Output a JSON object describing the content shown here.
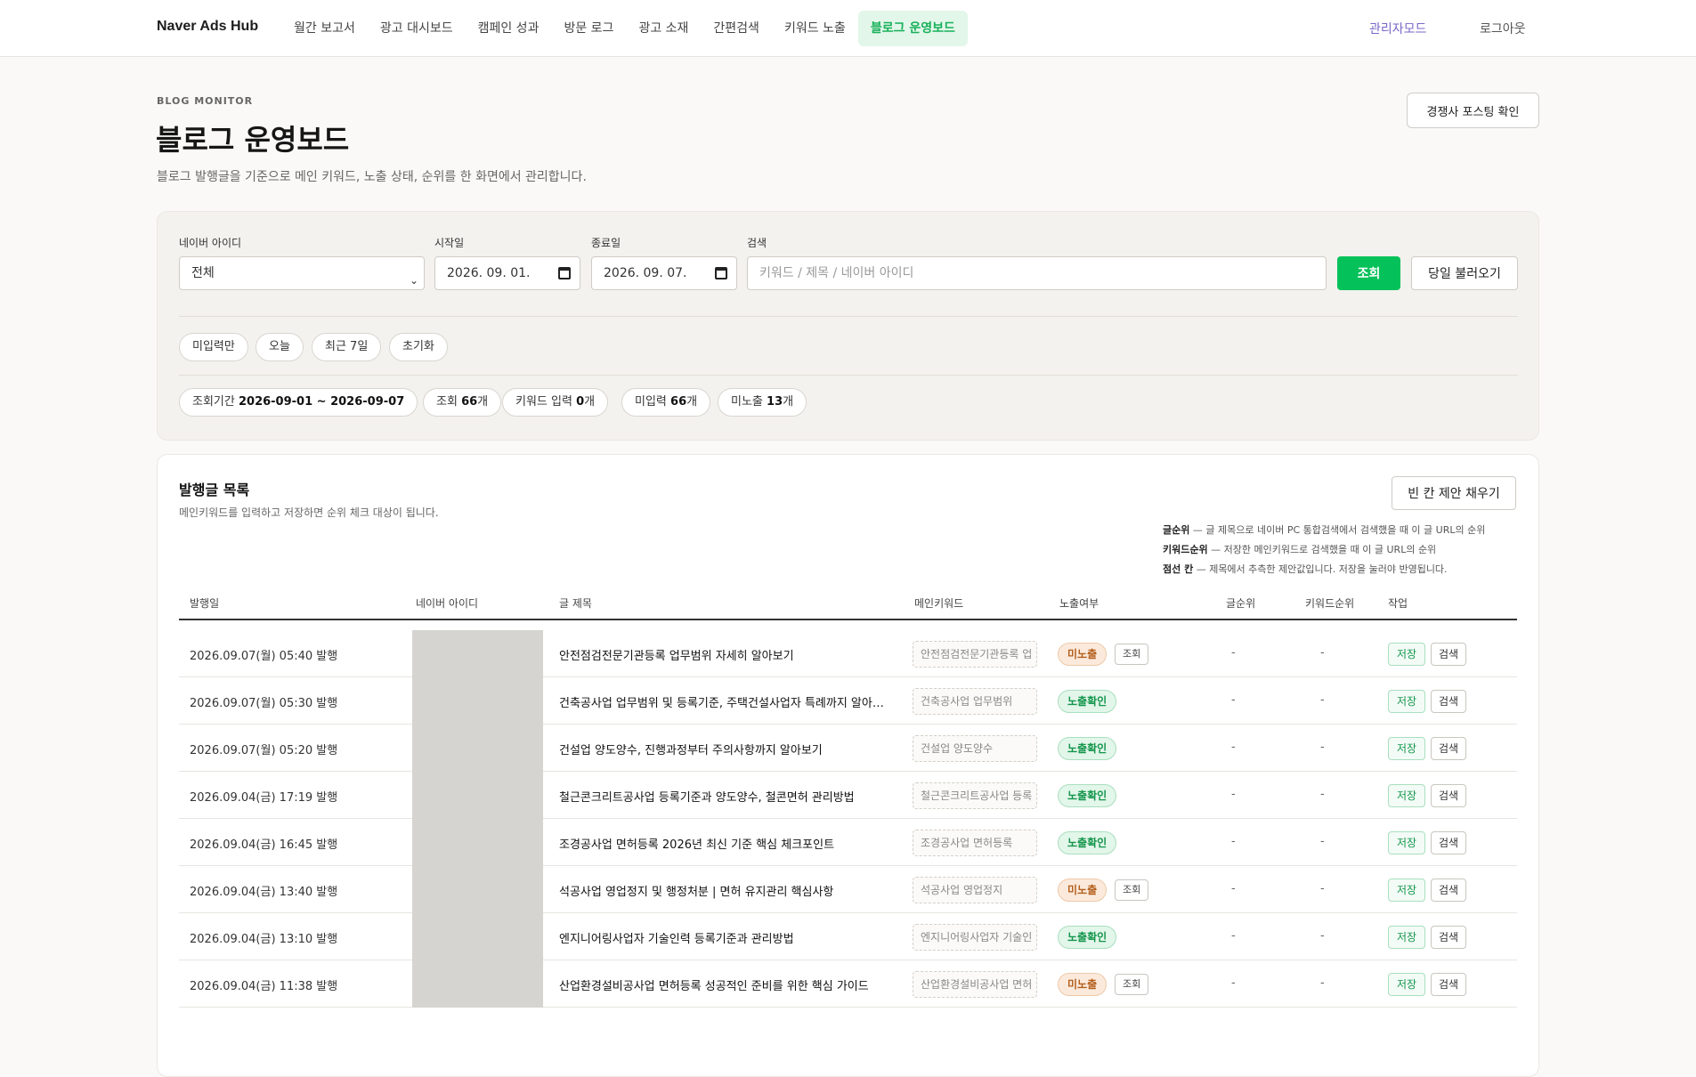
{
  "nav": {
    "brand": "Naver Ads Hub",
    "items": [
      {
        "label": "월간 보고서"
      },
      {
        "label": "광고 대시보드"
      },
      {
        "label": "캠페인 성과"
      },
      {
        "label": "방문 로그"
      },
      {
        "label": "광고 소재"
      },
      {
        "label": "간편검색"
      },
      {
        "label": "키워드 노출"
      },
      {
        "label": "블로그 운영보드"
      }
    ],
    "active_index": 7,
    "admin": "관리자모드",
    "logout": "로그아웃"
  },
  "header": {
    "eyebrow": "BLOG MONITOR",
    "title": "블로그 운영보드",
    "description": "블로그 발행글을 기준으로 메인 키워드, 노출 상태, 순위를 한 화면에서 관리합니다.",
    "competitor_button": "경쟁사 포스팅 확인"
  },
  "filters": {
    "naver_id_label": "네이버 아이디",
    "naver_id_value": "전체",
    "start_label": "시작일",
    "start_value": "2026. 09. 01.",
    "end_label": "종료일",
    "end_value": "2026. 09. 07.",
    "search_label": "검색",
    "search_placeholder": "키워드 / 제목 / 네이버 아이디",
    "submit": "조회",
    "load_today": "당일 불러오기",
    "quick": [
      "미입력만",
      "오늘",
      "최근 7일",
      "초기화"
    ],
    "summary": {
      "period_label": "조회기간",
      "period_value": "2026-09-01 ~ 2026-09-07",
      "count_label": "조회",
      "count_value": "66",
      "keyword_label": "키워드 입력",
      "keyword_value": "0",
      "missing_label": "미입력",
      "missing_value": "66",
      "notshown_label": "미노출",
      "notshown_value": "13",
      "unit": "개"
    }
  },
  "list": {
    "title": "발행글 목록",
    "description": "메인키워드를 입력하고 저장하면 순위 체크 대상이 됩니다.",
    "fill_button": "빈 칸 제안 채우기",
    "legend": [
      {
        "term": "글순위",
        "text": " — 글 제목으로 네이버 PC 통합검색에서 검색했을 때 이 글 URL의 순위"
      },
      {
        "term": "키워드순위",
        "text": " — 저장한 메인키워드로 검색했을 때 이 글 URL의 순위"
      },
      {
        "term": "점선 칸",
        "text": " — 제목에서 추측한 제안값입니다. 저장을 눌러야 반영됩니다."
      }
    ],
    "columns": [
      "발행일",
      "네이버 아이디",
      "글 제목",
      "메인키워드",
      "노출여부",
      "글순위",
      "키워드순위",
      "작업"
    ],
    "rows": [
      {
        "date": "2026.09.07(월) 05:40 발행",
        "title": "안전점검전문기관등록 업무범위 자세히 알아보기",
        "keyword": "안전점검전문기관등록 업",
        "status": "미노출",
        "status_type": "no",
        "check": "조회",
        "post_rank": "-",
        "kw_rank": "-",
        "save": "저장",
        "search": "검색"
      },
      {
        "date": "2026.09.07(월) 05:30 발행",
        "title": "건축공사업 업무범위 및 등록기준, 주택건설사업자 특례까지 알아보...",
        "keyword": "건축공사업 업무범위",
        "status": "노출확인",
        "status_type": "ok",
        "check": "",
        "post_rank": "-",
        "kw_rank": "-",
        "save": "저장",
        "search": "검색"
      },
      {
        "date": "2026.09.07(월) 05:20 발행",
        "title": "건설업 양도양수, 진행과정부터 주의사항까지 알아보기",
        "keyword": "건설업 양도양수",
        "status": "노출확인",
        "status_type": "ok",
        "check": "",
        "post_rank": "-",
        "kw_rank": "-",
        "save": "저장",
        "search": "검색"
      },
      {
        "date": "2026.09.04(금) 17:19 발행",
        "title": "철근콘크리트공사업 등록기준과 양도양수, 철콘면허 관리방법",
        "keyword": "철근콘크리트공사업 등록",
        "status": "노출확인",
        "status_type": "ok",
        "check": "",
        "post_rank": "-",
        "kw_rank": "-",
        "save": "저장",
        "search": "검색"
      },
      {
        "date": "2026.09.04(금) 16:45 발행",
        "title": "조경공사업 면허등록 2026년 최신 기준 핵심 체크포인트",
        "keyword": "조경공사업 면허등록",
        "status": "노출확인",
        "status_type": "ok",
        "check": "",
        "post_rank": "-",
        "kw_rank": "-",
        "save": "저장",
        "search": "검색"
      },
      {
        "date": "2026.09.04(금) 13:40 발행",
        "title": "석공사업 영업정지 및 행정처분 | 면허 유지관리 핵심사항",
        "keyword": "석공사업 영업정지",
        "status": "미노출",
        "status_type": "no",
        "check": "조회",
        "post_rank": "-",
        "kw_rank": "-",
        "save": "저장",
        "search": "검색"
      },
      {
        "date": "2026.09.04(금) 13:10 발행",
        "title": "엔지니어링사업자 기술인력 등록기준과 관리방법",
        "keyword": "엔지니어링사업자 기술인",
        "status": "노출확인",
        "status_type": "ok",
        "check": "",
        "post_rank": "-",
        "kw_rank": "-",
        "save": "저장",
        "search": "검색"
      },
      {
        "date": "2026.09.04(금) 11:38 발행",
        "title": "산업환경설비공사업 면허등록 성공적인 준비를 위한 핵심 가이드",
        "keyword": "산업환경설비공사업 면허",
        "status": "미노출",
        "status_type": "no",
        "check": "조회",
        "post_rank": "-",
        "kw_rank": "-",
        "save": "저장",
        "search": "검색"
      }
    ]
  }
}
